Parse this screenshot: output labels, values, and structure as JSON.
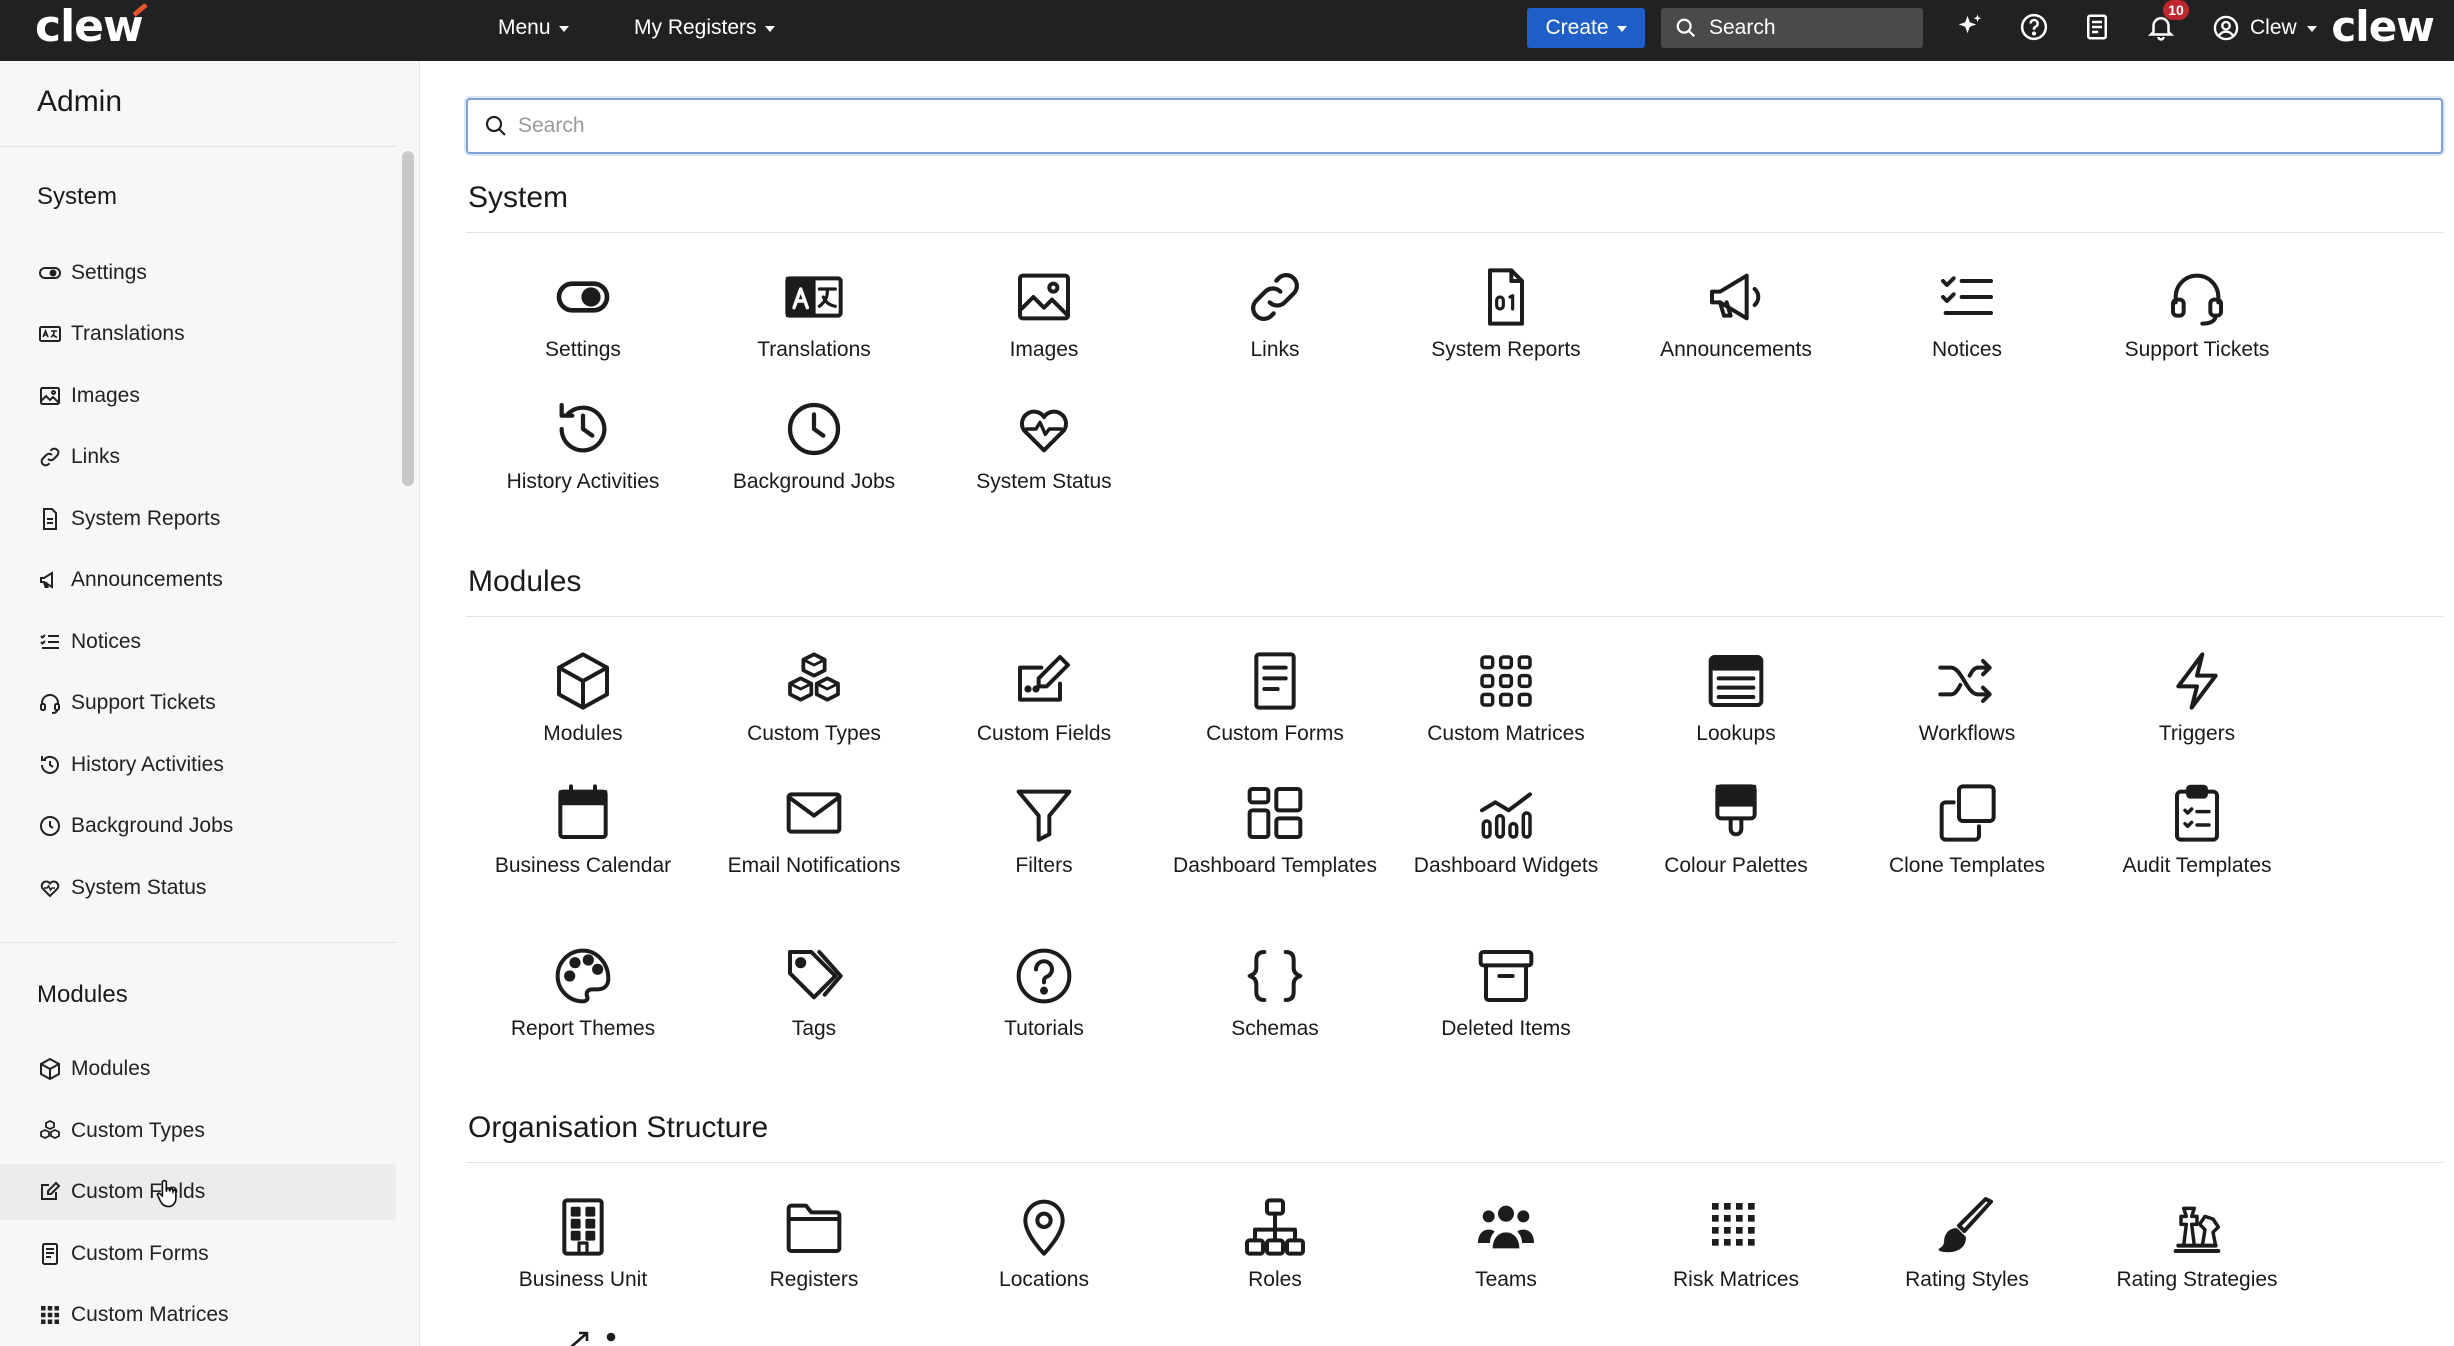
{
  "topbar": {
    "logo": "clew",
    "menu_label": "Menu",
    "registers_label": "My Registers",
    "create_label": "Create",
    "search_label": "Search",
    "notification_count": "10",
    "user_label": "Clew",
    "brand_right": "clew"
  },
  "sidebar": {
    "title": "Admin",
    "sections": [
      {
        "title": "System",
        "items": [
          {
            "label": "Settings",
            "icon": "toggle-icon"
          },
          {
            "label": "Translations",
            "icon": "translate-icon"
          },
          {
            "label": "Images",
            "icon": "image-icon"
          },
          {
            "label": "Links",
            "icon": "link-icon"
          },
          {
            "label": "System Reports",
            "icon": "report-icon"
          },
          {
            "label": "Announcements",
            "icon": "megaphone-icon"
          },
          {
            "label": "Notices",
            "icon": "list-check-icon"
          },
          {
            "label": "Support Tickets",
            "icon": "headset-icon"
          },
          {
            "label": "History Activities",
            "icon": "history-icon"
          },
          {
            "label": "Background Jobs",
            "icon": "clock-icon"
          },
          {
            "label": "System Status",
            "icon": "heart-pulse-icon"
          }
        ]
      },
      {
        "title": "Modules",
        "items": [
          {
            "label": "Modules",
            "icon": "cube-icon"
          },
          {
            "label": "Custom Types",
            "icon": "cubes-icon"
          },
          {
            "label": "Custom Fields",
            "icon": "edit-field-icon"
          },
          {
            "label": "Custom Forms",
            "icon": "form-icon"
          },
          {
            "label": "Custom Matrices",
            "icon": "grid-icon"
          }
        ]
      }
    ]
  },
  "main": {
    "search_placeholder": "Search",
    "sections": [
      {
        "title": "System",
        "tiles": [
          "Settings",
          "Translations",
          "Images",
          "Links",
          "System Reports",
          "Announcements",
          "Notices",
          "Support Tickets",
          "History Activities",
          "Background Jobs",
          "System Status"
        ]
      },
      {
        "title": "Modules",
        "tiles": [
          "Modules",
          "Custom Types",
          "Custom Fields",
          "Custom Forms",
          "Custom Matrices",
          "Lookups",
          "Workflows",
          "Triggers",
          "Business Calendar",
          "Email Notifications",
          "Filters",
          "Dashboard Templates",
          "Dashboard Widgets",
          "Colour Palettes",
          "Clone Templates",
          "Audit Templates",
          "Report Themes",
          "Tags",
          "Tutorials",
          "Schemas",
          "Deleted Items"
        ]
      },
      {
        "title": "Organisation Structure",
        "tiles": [
          "Business Unit",
          "Registers",
          "Locations",
          "Roles",
          "Teams",
          "Risk Matrices",
          "Rating Styles",
          "Rating Strategies"
        ]
      }
    ]
  },
  "colors": {
    "topbar": "#212121",
    "create_button": "#1f5fc7",
    "badge": "#c0262d",
    "logo_accent": "#e8542d"
  }
}
